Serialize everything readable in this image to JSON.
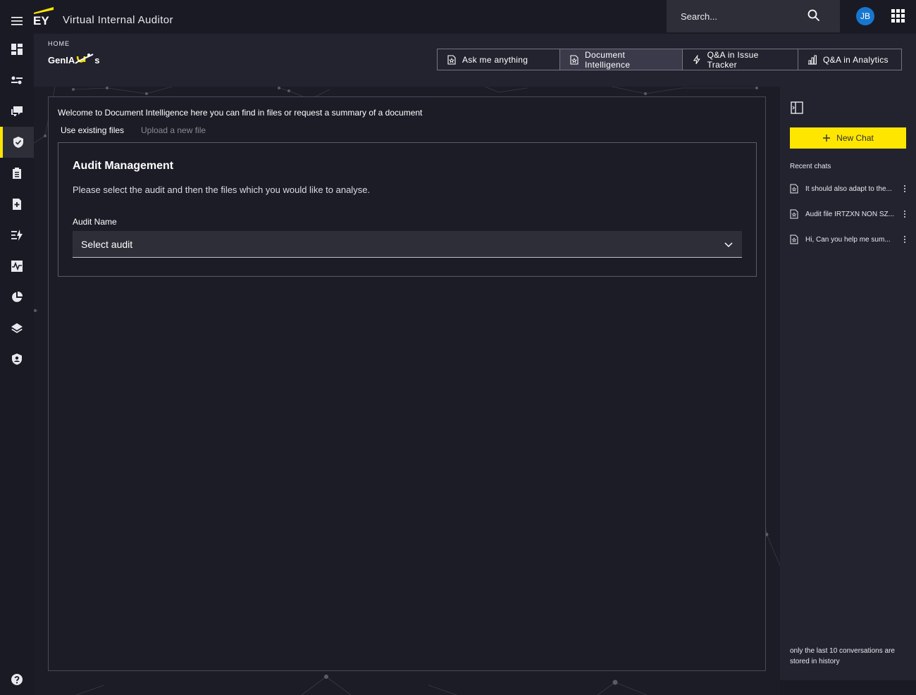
{
  "header": {
    "brand": "EY",
    "app_title": "Virtual Internal Auditor",
    "search_placeholder": "Search...",
    "user_initials": "JB"
  },
  "subheader": {
    "breadcrumb": "HOME",
    "product_logo_text": "GenIA",
    "product_logo_suffix": "s",
    "mode_tabs": [
      {
        "label": "Ask me anything",
        "icon": "document-star-icon",
        "active": false
      },
      {
        "label": "Document Intelligence",
        "icon": "document-star-icon",
        "active": true
      },
      {
        "label": "Q&A in Issue Tracker",
        "icon": "lightning-icon",
        "active": false
      },
      {
        "label": "Q&A in Analytics",
        "icon": "bar-chart-icon",
        "active": false
      }
    ]
  },
  "nav": {
    "items": [
      {
        "icon": "dashboard-icon"
      },
      {
        "icon": "settings-sliders-icon"
      },
      {
        "icon": "chat-icon"
      },
      {
        "icon": "shield-check-icon",
        "active": true
      },
      {
        "icon": "clipboard-icon"
      },
      {
        "icon": "document-add-icon"
      },
      {
        "icon": "list-lightning-icon"
      },
      {
        "icon": "activity-icon"
      },
      {
        "icon": "pie-chart-icon"
      },
      {
        "icon": "layers-icon"
      },
      {
        "icon": "user-shield-icon"
      }
    ],
    "help_icon": "help-icon"
  },
  "main": {
    "welcome": "Welcome to Document Intelligence here you can find in files or request a summary of a document",
    "tabs": [
      {
        "label": "Use existing files",
        "active": true
      },
      {
        "label": "Upload a new file",
        "active": false
      }
    ],
    "card": {
      "title": "Audit Management",
      "description": "Please select the audit and then the files which you would like to analyse.",
      "field_label": "Audit Name",
      "select_value": "Select audit"
    }
  },
  "sidebar": {
    "new_chat_label": "New Chat",
    "recent_title": "Recent chats",
    "recent_chats": [
      {
        "label": "It should also adapt to the..."
      },
      {
        "label": "Audit file IRTZXN NON SZ..."
      },
      {
        "label": "Hi, Can you help me sum..."
      }
    ],
    "history_note": "only the last 10 conversations are stored in history"
  },
  "colors": {
    "accent": "#ffe600",
    "background": "#1a1a24",
    "panel": "#23232f",
    "avatar": "#1777cf"
  }
}
